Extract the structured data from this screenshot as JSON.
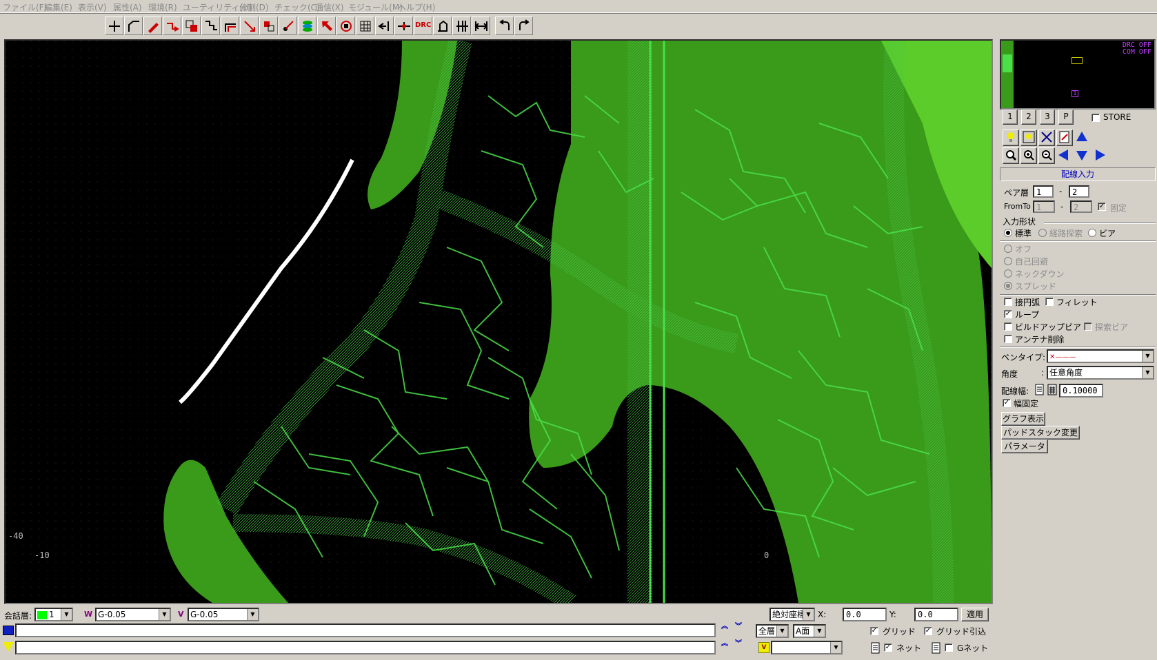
{
  "menu": [
    "ファイル(F)",
    "編集(E)",
    "表示(V)",
    "属性(A)",
    "環境(R)",
    "ユーティリティ(U)",
    "分割(D)",
    "チェック(C)",
    "通信(X)",
    "モジュール(M)",
    "ヘルプ(H)"
  ],
  "toolbar": {
    "drc_label": "DRC",
    "tools": [
      "wire-tool-icon",
      "corner-tool-icon",
      "pen-tool-icon",
      "connect-tool-icon",
      "copy-tool-icon",
      "layer-tool-icon",
      "bend-tool-icon",
      "move-tool-icon",
      "wire-move-icon",
      "node-tool-icon",
      "via-stack-icon",
      "select-tool-icon",
      "rotate-tool-icon",
      "grid-tool-icon",
      "push-tool-icon",
      "slide-tool-icon",
      "drc-icon",
      "measure-icon",
      "align-icon",
      "fit-icon",
      "undo-icon",
      "redo-icon"
    ]
  },
  "canvas": {
    "axis_y_label": "-40",
    "axis_x_left": "-10",
    "axis_x_right": "0"
  },
  "minimap": {
    "drc_status": "DRC OFF",
    "com_status": "COM OFF",
    "marker_label": "1"
  },
  "side": {
    "view_buttons": [
      "1",
      "2",
      "3",
      "P"
    ],
    "store_label": "STORE",
    "mode_title": "配線入力",
    "pair_layer_label": "ペア層",
    "pair_from": "1",
    "pair_to": "2",
    "fromto_label": "FromTo",
    "fromto_from": "1",
    "fromto_to": "2",
    "fixed_label": "固定",
    "input_shape_label": "入力形状",
    "shape_standard": "標準",
    "shape_route": "経路探索",
    "shape_via": "ビア",
    "opt_off": "オフ",
    "opt_self_avoid": "自己回避",
    "opt_neckdown": "ネックダウン",
    "opt_spread": "スプレッド",
    "tangent_arc": "接円弧",
    "fillet": "フィレット",
    "loop": "ループ",
    "buildup_via": "ビルドアップビア",
    "search_via": "探索ビア",
    "antenna_delete": "アンテナ削除",
    "pen_type_label": "ペンタイプ:",
    "angle_label": "角度",
    "angle_value": "任意角度",
    "wire_width_label": "配線幅:",
    "wire_width_value": "0.10000",
    "width_fixed": "幅固定",
    "graph_button": "グラフ表示",
    "padstack_button": "パッドスタック変更",
    "param_button": "パラメータ"
  },
  "bottom": {
    "layer_label": "会話層:",
    "layer_value": "1",
    "wire_value": "G-0.05",
    "via_value": "G-0.05",
    "coord_mode": "絶対座標",
    "x_label": "X:",
    "x_value": "0.0",
    "y_label": "Y:",
    "y_value": "0.0",
    "apply_button": "適用",
    "all_layers": "全層",
    "side_a": "A面",
    "grid": "グリッド",
    "grid_snap": "グリッド引込",
    "net": "ネット",
    "gnet": "Gネット"
  },
  "colors": {
    "copper_fill": "#3a9a1a",
    "copper_bright": "#5ccc2a",
    "trace_outline": "#4ae04a",
    "selected_wire": "#ffffff",
    "background": "#000000"
  }
}
